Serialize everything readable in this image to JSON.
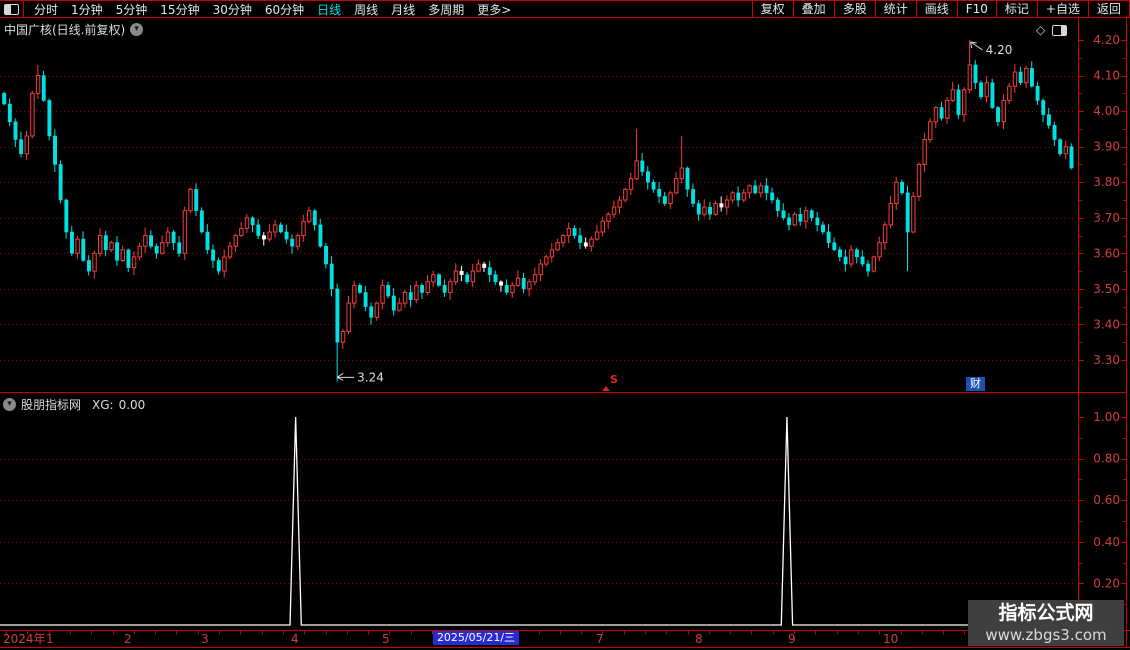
{
  "toolbar": {
    "periods": [
      "分时",
      "1分钟",
      "5分钟",
      "15分钟",
      "30分钟",
      "60分钟",
      "日线",
      "周线",
      "月线",
      "多周期",
      "更多>"
    ],
    "active_period_index": 6,
    "right_items": [
      "复权",
      "叠加",
      "多股",
      "统计",
      "画线",
      "F10",
      "标记",
      "+自选",
      "返回"
    ]
  },
  "chart_header": {
    "title": "中国广核(日线.前复权)"
  },
  "indicator": {
    "name": "股朋指标网",
    "xg_label": "XG:",
    "xg_value": "0.00",
    "y_ticks": [
      "1.00",
      "0.80",
      "0.60",
      "0.40",
      "0.20"
    ],
    "spike_indices": [
      52,
      139
    ],
    "spike_value": 1.0
  },
  "chart_data": {
    "type": "candlestick",
    "title": "中国广核 日线 前复权",
    "y_ticks": [
      "4.20",
      "4.10",
      "4.00",
      "3.90",
      "3.80",
      "3.70",
      "3.60",
      "3.50",
      "3.40",
      "3.30"
    ],
    "ylim": [
      3.24,
      4.2
    ],
    "first_open": 4.05,
    "closes": [
      4.02,
      3.97,
      3.92,
      3.88,
      3.93,
      4.05,
      4.1,
      4.03,
      3.93,
      3.85,
      3.75,
      3.66,
      3.6,
      3.64,
      3.58,
      3.55,
      3.6,
      3.65,
      3.61,
      3.63,
      3.58,
      3.61,
      3.56,
      3.59,
      3.62,
      3.65,
      3.62,
      3.6,
      3.63,
      3.66,
      3.63,
      3.6,
      3.72,
      3.78,
      3.72,
      3.66,
      3.61,
      3.58,
      3.55,
      3.59,
      3.62,
      3.65,
      3.67,
      3.7,
      3.68,
      3.65,
      3.64,
      3.66,
      3.68,
      3.66,
      3.64,
      3.62,
      3.65,
      3.69,
      3.72,
      3.68,
      3.62,
      3.57,
      3.5,
      3.35,
      3.38,
      3.46,
      3.51,
      3.49,
      3.45,
      3.42,
      3.46,
      3.51,
      3.48,
      3.44,
      3.46,
      3.49,
      3.47,
      3.51,
      3.49,
      3.52,
      3.54,
      3.51,
      3.49,
      3.52,
      3.55,
      3.54,
      3.52,
      3.55,
      3.57,
      3.56,
      3.54,
      3.52,
      3.51,
      3.49,
      3.51,
      3.53,
      3.5,
      3.52,
      3.54,
      3.57,
      3.59,
      3.61,
      3.63,
      3.65,
      3.67,
      3.65,
      3.63,
      3.62,
      3.64,
      3.66,
      3.69,
      3.71,
      3.73,
      3.75,
      3.78,
      3.81,
      3.86,
      3.83,
      3.8,
      3.78,
      3.76,
      3.74,
      3.77,
      3.81,
      3.84,
      3.78,
      3.74,
      3.71,
      3.73,
      3.71,
      3.74,
      3.73,
      3.75,
      3.77,
      3.75,
      3.77,
      3.79,
      3.77,
      3.79,
      3.77,
      3.75,
      3.72,
      3.7,
      3.68,
      3.71,
      3.69,
      3.72,
      3.7,
      3.68,
      3.66,
      3.63,
      3.61,
      3.59,
      3.57,
      3.61,
      3.59,
      3.57,
      3.55,
      3.59,
      3.63,
      3.68,
      3.74,
      3.8,
      3.77,
      3.66,
      3.76,
      3.85,
      3.92,
      3.97,
      4.01,
      3.98,
      4.03,
      4.06,
      3.99,
      4.06,
      4.13,
      4.08,
      4.04,
      4.08,
      4.01,
      3.97,
      4.03,
      4.07,
      4.11,
      4.08,
      4.12,
      4.07,
      4.03,
      3.99,
      3.96,
      3.92,
      3.88,
      3.9,
      3.84
    ],
    "extremes": {
      "6": {
        "high": 4.13
      },
      "59": {
        "low": 3.24
      },
      "112": {
        "high": 3.95
      },
      "120": {
        "high": 3.93
      },
      "160": {
        "low": 3.55
      },
      "171": {
        "high": 4.2
      }
    },
    "annotations": {
      "high": {
        "text": "4.20",
        "index": 171,
        "value": 4.2
      },
      "low": {
        "text": "3.24",
        "index": 59,
        "value": 3.24
      }
    },
    "markers": {
      "s_event": {
        "label": "S"
      },
      "financial_report": {
        "label": "财"
      }
    }
  },
  "timeline": {
    "labels": [
      {
        "t": "2024年",
        "x": 3
      },
      {
        "t": "1",
        "x": 46
      },
      {
        "t": "2",
        "x": 124
      },
      {
        "t": "3",
        "x": 201
      },
      {
        "t": "4",
        "x": 291
      },
      {
        "t": "5",
        "x": 382
      },
      {
        "t": "7",
        "x": 596
      },
      {
        "t": "8",
        "x": 695
      },
      {
        "t": "9",
        "x": 788
      },
      {
        "t": "10",
        "x": 883
      }
    ],
    "selected": {
      "label": "2025/05/21/三",
      "x": 433
    }
  },
  "watermark": {
    "line1": "指标公式网",
    "line2": "www.zbgs3.com"
  },
  "colors": {
    "border": "#c80000",
    "grid": "#9c0000",
    "axis_text": "#d23c3c",
    "up": "#f83b3b",
    "down": "#00e2e2",
    "flat": "#ffffff",
    "indicator_line": "#ffffff",
    "annotation": "#dcdcdc",
    "highlight_bg": "#2a2ad2",
    "fin_bg": "#1e4fb4",
    "event_red": "#e02222",
    "active_tab": "#00e2e2"
  }
}
